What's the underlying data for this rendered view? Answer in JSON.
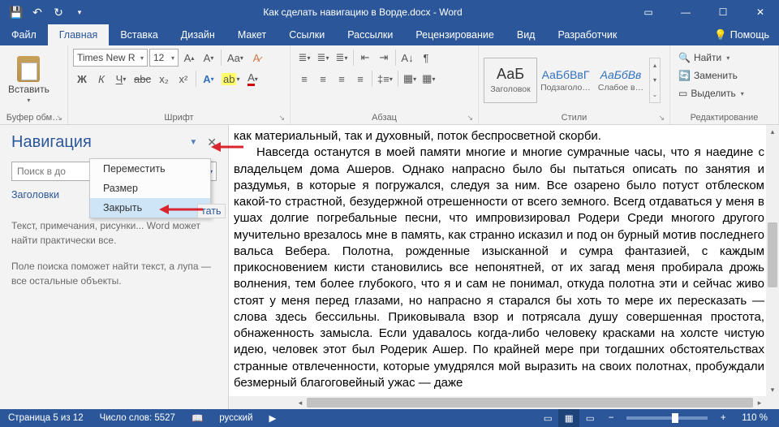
{
  "titlebar": {
    "doc_title": "Как сделать навигацию в Ворде.docx - Word"
  },
  "menu": {
    "file": "Файл",
    "home": "Главная",
    "insert": "Вставка",
    "design": "Дизайн",
    "layout": "Макет",
    "references": "Ссылки",
    "mailings": "Рассылки",
    "review": "Рецензирование",
    "view": "Вид",
    "developer": "Разработчик",
    "help": "Помощь"
  },
  "ribbon": {
    "clipboard": {
      "label": "Буфер обм…",
      "paste": "Вставить"
    },
    "font": {
      "label": "Шрифт",
      "font_name": "Times New R",
      "font_size": "12"
    },
    "paragraph": {
      "label": "Абзац"
    },
    "styles": {
      "label": "Стили",
      "preview_text1": "АаБ",
      "preview_text2": "АаБбВвГ",
      "preview_text3": "АаБбВв",
      "style1": "Заголовок",
      "style2": "Подзаголо…",
      "style3": "Слабое в…"
    },
    "editing": {
      "label": "Редактирование",
      "find": "Найти",
      "replace": "Заменить",
      "select": "Выделить"
    }
  },
  "nav": {
    "title": "Навигация",
    "search_placeholder": "Поиск в до",
    "tab_headings": "Заголовки",
    "tab_results": "тать",
    "hint1": "Текст, примечания, рисунки... Word может найти практически все.",
    "hint2": "Поле поиска поможет найти текст, а лупа — все остальные объекты."
  },
  "dropdown": {
    "move": "Переместить",
    "size": "Размер",
    "close": "Закрыть"
  },
  "document": {
    "line0": "как материальный, так и духовный, поток беспросветной скорби.",
    "para": "Навсегда останутся в моей памяти многие и многие сумрачные часы, что я наедине с владельцем дома Ашеров. Однако напрасно было бы пытаться описать по занятия и раздумья, в которые я погружался, следуя за ним. Все озарено было потуст отблеском какой-то страстной, безудержной отрешенности от всего земного. Всегд отдаваться у меня в ушах долгие погребальные песни, что импровизировал Родери Среди многого другого мучительно врезалось мне в память, как странно исказил и под он бурный мотив последнего вальса Вебера. Полотна, рожденные изысканной и сумра фантазией, с каждым прикосновением кисти становились все непонятней, от их загад меня пробирала дрожь волнения, тем более глубокого, что я и сам не понимал, откуда полотна эти и сейчас живо стоят у меня перед глазами, но напрасно я старался бы хоть то мере их пересказать — слова здесь бессильны. Приковывала взор и потрясала душу совершенная простота, обнаженность замысла. Если удавалось когда-либо человеку красками на холсте чистую идею, человек этот был Родерик Ашер. По крайней мере при тогдашних обстоятельствах странные отвлеченности, которые умудрялся мой выразить на своих полотнах, пробуждали безмерный благоговейный ужас — даже"
  },
  "status": {
    "page": "Страница 5 из 12",
    "words": "Число слов: 5527",
    "lang": "русский",
    "zoom": "110 %"
  }
}
